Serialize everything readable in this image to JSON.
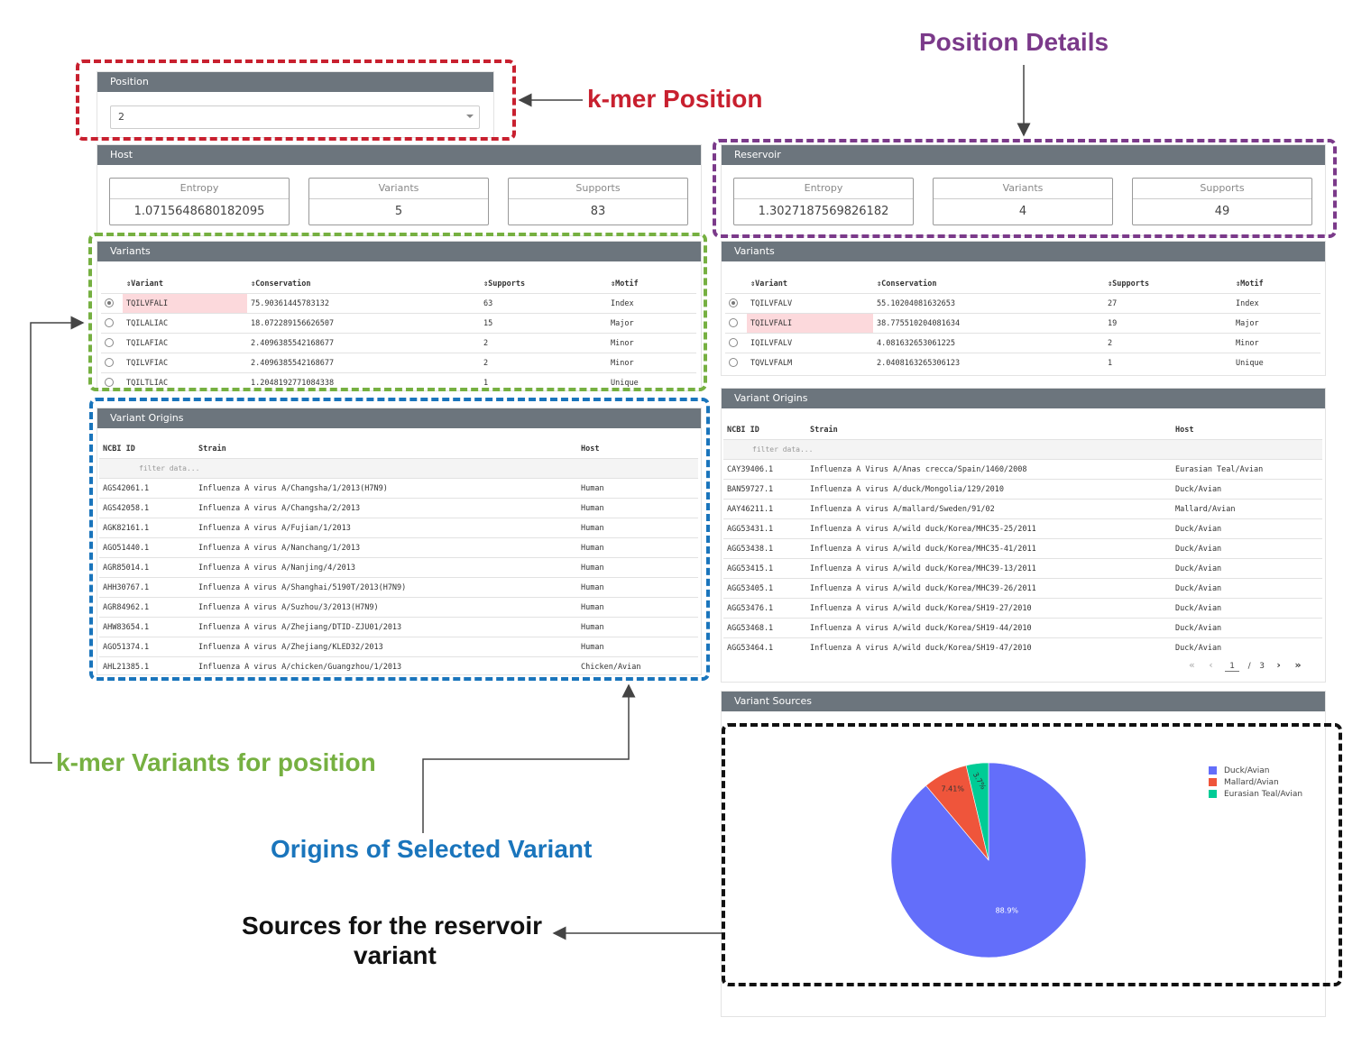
{
  "position": {
    "header": "Position",
    "value": "2"
  },
  "host": {
    "header": "Host",
    "stats": [
      {
        "label": "Entropy",
        "value": "1.0715648680182095"
      },
      {
        "label": "Variants",
        "value": "5"
      },
      {
        "label": "Supports",
        "value": "83"
      }
    ],
    "variants": {
      "header": "Variants",
      "columns": [
        "⇕Variant",
        "⇕Conservation",
        "⇕Supports",
        "⇕Motif"
      ],
      "rows": [
        {
          "variant": "TQILVFALI",
          "conservation": "75.90361445783132",
          "supports": "63",
          "motif": "Index"
        },
        {
          "variant": "TQILALIAC",
          "conservation": "18.072289156626507",
          "supports": "15",
          "motif": "Major"
        },
        {
          "variant": "TQILAFIAC",
          "conservation": "2.4096385542168677",
          "supports": "2",
          "motif": "Minor"
        },
        {
          "variant": "TQILVFIAC",
          "conservation": "2.4096385542168677",
          "supports": "2",
          "motif": "Minor"
        },
        {
          "variant": "TQILTLIAC",
          "conservation": "1.2048192771084338",
          "supports": "1",
          "motif": "Unique"
        }
      ]
    },
    "origins": {
      "header": "Variant Origins",
      "columns": [
        "NCBI ID",
        "Strain",
        "Host"
      ],
      "filter_placeholder": "filter data...",
      "rows": [
        {
          "id": "AGS42061.1",
          "strain": "Influenza A virus A/Changsha/1/2013(H7N9)",
          "host": "Human"
        },
        {
          "id": "AGS42058.1",
          "strain": "Influenza A virus A/Changsha/2/2013",
          "host": "Human"
        },
        {
          "id": "AGK82161.1",
          "strain": "Influenza A virus A/Fujian/1/2013",
          "host": "Human"
        },
        {
          "id": "AGO51440.1",
          "strain": "Influenza A virus A/Nanchang/1/2013",
          "host": "Human"
        },
        {
          "id": "AGR85014.1",
          "strain": "Influenza A virus A/Nanjing/4/2013",
          "host": "Human"
        },
        {
          "id": "AHH30767.1",
          "strain": "Influenza A virus A/Shanghai/5190T/2013(H7N9)",
          "host": "Human"
        },
        {
          "id": "AGR84962.1",
          "strain": "Influenza A virus A/Suzhou/3/2013(H7N9)",
          "host": "Human"
        },
        {
          "id": "AHW83654.1",
          "strain": "Influenza A virus A/Zhejiang/DTID-ZJU01/2013",
          "host": "Human"
        },
        {
          "id": "AGO51374.1",
          "strain": "Influenza A virus A/Zhejiang/KLED32/2013",
          "host": "Human"
        },
        {
          "id": "AHL21385.1",
          "strain": "Influenza A virus A/chicken/Guangzhou/1/2013",
          "host": "Chicken/Avian"
        }
      ]
    }
  },
  "reservoir": {
    "header": "Reservoir",
    "stats": [
      {
        "label": "Entropy",
        "value": "1.3027187569826182"
      },
      {
        "label": "Variants",
        "value": "4"
      },
      {
        "label": "Supports",
        "value": "49"
      }
    ],
    "variants": {
      "header": "Variants",
      "columns": [
        "⇕Variant",
        "⇕Conservation",
        "⇕Supports",
        "⇕Motif"
      ],
      "rows": [
        {
          "variant": "TQILVFALV",
          "conservation": "55.10204081632653",
          "supports": "27",
          "motif": "Index"
        },
        {
          "variant": "TQILVFALI",
          "conservation": "38.775510204081634",
          "supports": "19",
          "motif": "Major"
        },
        {
          "variant": "IQILVFALV",
          "conservation": "4.081632653061225",
          "supports": "2",
          "motif": "Minor"
        },
        {
          "variant": "TQVLVFALM",
          "conservation": "2.0408163265306123",
          "supports": "1",
          "motif": "Unique"
        }
      ]
    },
    "origins": {
      "header": "Variant Origins",
      "columns": [
        "NCBI ID",
        "Strain",
        "Host"
      ],
      "filter_placeholder": "filter data...",
      "rows": [
        {
          "id": "CAY39406.1",
          "strain": "Influenza A Virus A/Anas crecca/Spain/1460/2008",
          "host": "Eurasian Teal/Avian"
        },
        {
          "id": "BAN59727.1",
          "strain": "Influenza A virus A/duck/Mongolia/129/2010",
          "host": "Duck/Avian"
        },
        {
          "id": "AAY46211.1",
          "strain": "Influenza A virus A/mallard/Sweden/91/02",
          "host": "Mallard/Avian"
        },
        {
          "id": "AGG53431.1",
          "strain": "Influenza A virus A/wild duck/Korea/MHC35-25/2011",
          "host": "Duck/Avian"
        },
        {
          "id": "AGG53438.1",
          "strain": "Influenza A virus A/wild duck/Korea/MHC35-41/2011",
          "host": "Duck/Avian"
        },
        {
          "id": "AGG53415.1",
          "strain": "Influenza A virus A/wild duck/Korea/MHC39-13/2011",
          "host": "Duck/Avian"
        },
        {
          "id": "AGG53405.1",
          "strain": "Influenza A virus A/wild duck/Korea/MHC39-26/2011",
          "host": "Duck/Avian"
        },
        {
          "id": "AGG53476.1",
          "strain": "Influenza A virus A/wild duck/Korea/SH19-27/2010",
          "host": "Duck/Avian"
        },
        {
          "id": "AGG53468.1",
          "strain": "Influenza A virus A/wild duck/Korea/SH19-44/2010",
          "host": "Duck/Avian"
        },
        {
          "id": "AGG53464.1",
          "strain": "Influenza A virus A/wild duck/Korea/SH19-47/2010",
          "host": "Duck/Avian"
        }
      ],
      "pager": {
        "first": "«",
        "prev": "‹",
        "page": "1",
        "sep": "/",
        "total": "3",
        "next": "›",
        "last": "»"
      }
    },
    "sources": {
      "header": "Variant Sources"
    }
  },
  "chart_data": {
    "type": "pie",
    "labels": [
      "Duck/Avian",
      "Mallard/Avian",
      "Eurasian Teal/Avian"
    ],
    "values": [
      88.9,
      7.41,
      3.7
    ],
    "slice_labels": [
      "88.9%",
      "7.41%",
      "3.7%"
    ],
    "colors": [
      "#636efa",
      "#ef553b",
      "#00cc96"
    ],
    "legend_position": "top-right"
  },
  "annotations": {
    "kmer_position": "k-mer Position",
    "position_details": "Position Details",
    "kmer_variants": "k-mer Variants for position",
    "origins_selected": "Origins of Selected Variant",
    "sources_line1": "Sources for the reservoir",
    "sources_line2": "variant"
  },
  "colors": {
    "annot_red": "#c8202f",
    "annot_purple": "#7b3a8a",
    "annot_green": "#76b041",
    "annot_blue": "#1a75bc",
    "annot_black": "#111111",
    "header_gray": "#6c757d",
    "highlight": "#fcd9dc"
  }
}
